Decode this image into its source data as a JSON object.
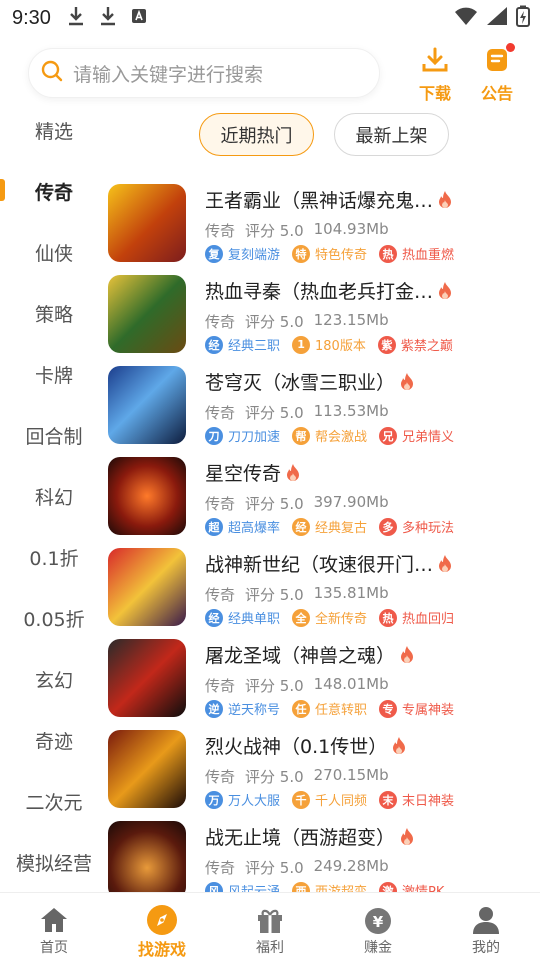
{
  "status_bar": {
    "time": "9:30"
  },
  "search": {
    "placeholder": "请输入关键字进行搜索"
  },
  "top_actions": {
    "download_label": "下载",
    "notice_label": "公告"
  },
  "sidebar": {
    "items": [
      {
        "label": "精选"
      },
      {
        "label": "传奇"
      },
      {
        "label": "仙侠"
      },
      {
        "label": "策略"
      },
      {
        "label": "卡牌"
      },
      {
        "label": "回合制"
      },
      {
        "label": "科幻"
      },
      {
        "label": "0.1折"
      },
      {
        "label": "0.05折"
      },
      {
        "label": "玄幻"
      },
      {
        "label": "奇迹"
      },
      {
        "label": "二次元"
      },
      {
        "label": "模拟经营"
      }
    ],
    "active_index": 1
  },
  "tabs": [
    {
      "label": "近期热门"
    },
    {
      "label": "最新上架"
    }
  ],
  "games": [
    {
      "title": "王者霸业（黑神话爆充鬼…",
      "category": "传奇",
      "rating": "评分 5.0",
      "size": "104.93Mb",
      "tags": [
        {
          "icon": "复",
          "text": "复刻端游",
          "color": "#4a8fe0"
        },
        {
          "icon": "特",
          "text": "特色传奇",
          "color": "#f5a13a"
        },
        {
          "icon": "热",
          "text": "热血重燃",
          "color": "#ef5a4a"
        }
      ]
    },
    {
      "title": "热血寻秦（热血老兵打金…",
      "category": "传奇",
      "rating": "评分 5.0",
      "size": "123.15Mb",
      "tags": [
        {
          "icon": "经",
          "text": "经典三职",
          "color": "#4a8fe0"
        },
        {
          "icon": "1",
          "text": "180版本",
          "color": "#f5a13a"
        },
        {
          "icon": "紫",
          "text": "紫禁之巅",
          "color": "#ef5a4a"
        }
      ]
    },
    {
      "title": "苍穹灭（冰雪三职业）",
      "category": "传奇",
      "rating": "评分 5.0",
      "size": "113.53Mb",
      "tags": [
        {
          "icon": "刀",
          "text": "刀刀加速",
          "color": "#4a8fe0"
        },
        {
          "icon": "帮",
          "text": "帮会激战",
          "color": "#f5a13a"
        },
        {
          "icon": "兄",
          "text": "兄弟情义",
          "color": "#ef5a4a"
        }
      ]
    },
    {
      "title": "星空传奇",
      "category": "传奇",
      "rating": "评分 5.0",
      "size": "397.90Mb",
      "tags": [
        {
          "icon": "超",
          "text": "超高爆率",
          "color": "#4a8fe0"
        },
        {
          "icon": "经",
          "text": "经典复古",
          "color": "#f5a13a"
        },
        {
          "icon": "多",
          "text": "多种玩法",
          "color": "#ef5a4a"
        }
      ]
    },
    {
      "title": "战神新世纪（攻速很开门…",
      "category": "传奇",
      "rating": "评分 5.0",
      "size": "135.81Mb",
      "tags": [
        {
          "icon": "经",
          "text": "经典单职",
          "color": "#4a8fe0"
        },
        {
          "icon": "全",
          "text": "全新传奇",
          "color": "#f5a13a"
        },
        {
          "icon": "热",
          "text": "热血回归",
          "color": "#ef5a4a"
        }
      ]
    },
    {
      "title": "屠龙圣域（神兽之魂）",
      "category": "传奇",
      "rating": "评分 5.0",
      "size": "148.01Mb",
      "tags": [
        {
          "icon": "逆",
          "text": "逆天称号",
          "color": "#4a8fe0"
        },
        {
          "icon": "任",
          "text": "任意转职",
          "color": "#f5a13a"
        },
        {
          "icon": "专",
          "text": "专属神装",
          "color": "#ef5a4a"
        }
      ]
    },
    {
      "title": "烈火战神（0.1传世）",
      "category": "传奇",
      "rating": "评分 5.0",
      "size": "270.15Mb",
      "tags": [
        {
          "icon": "万",
          "text": "万人大服",
          "color": "#4a8fe0"
        },
        {
          "icon": "千",
          "text": "千人同频",
          "color": "#f5a13a"
        },
        {
          "icon": "末",
          "text": "末日神装",
          "color": "#ef5a4a"
        }
      ]
    },
    {
      "title": "战无止境（西游超变）",
      "category": "传奇",
      "rating": "评分 5.0",
      "size": "249.28Mb",
      "tags": [
        {
          "icon": "风",
          "text": "风起云涌",
          "color": "#4a8fe0"
        },
        {
          "icon": "西",
          "text": "西游超变",
          "color": "#f5a13a"
        },
        {
          "icon": "激",
          "text": "激情PK",
          "color": "#ef5a4a"
        }
      ]
    }
  ],
  "bottom_nav": [
    {
      "label": "首页",
      "icon": "home-icon"
    },
    {
      "label": "找游戏",
      "icon": "compass-icon"
    },
    {
      "label": "福利",
      "icon": "gift-icon"
    },
    {
      "label": "赚金",
      "icon": "money-bag-icon"
    },
    {
      "label": "我的",
      "icon": "user-icon"
    }
  ],
  "colors": {
    "accent": "#f59a12",
    "tag_blue": "#4a8fe0",
    "tag_orange": "#f5a13a",
    "tag_red": "#ef5a4a"
  }
}
